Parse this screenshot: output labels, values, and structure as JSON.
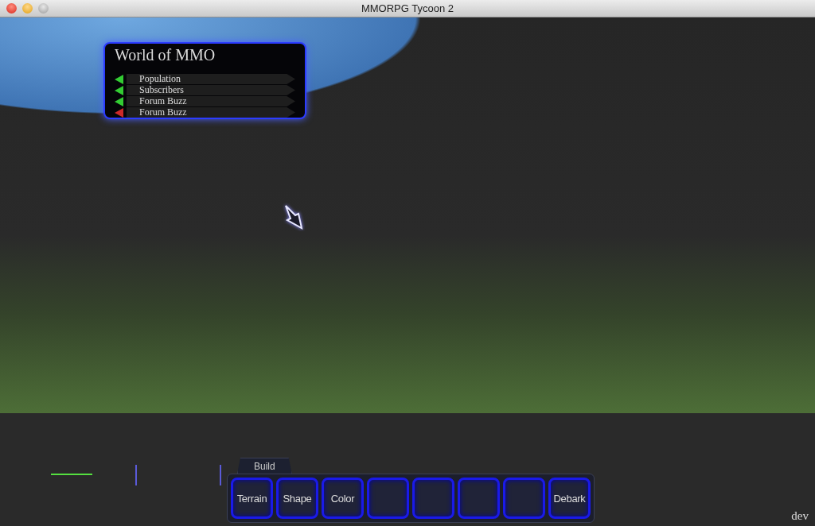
{
  "window": {
    "title": "MMORPG Tycoon 2"
  },
  "game_panel": {
    "title": "World of MMO",
    "stats": [
      {
        "label": "Population",
        "color": "#33cc33"
      },
      {
        "label": "Subscribers",
        "color": "#33cc33"
      },
      {
        "label": "Forum Buzz",
        "color": "#33cc33"
      },
      {
        "label": "Forum Buzz",
        "color": "#cc2a2a"
      }
    ]
  },
  "toolbar": {
    "tab": "Build",
    "slots": [
      {
        "kind": "tool",
        "label": "Terrain"
      },
      {
        "kind": "tool",
        "label": "Shape"
      },
      {
        "kind": "tool",
        "label": "Color"
      },
      {
        "kind": "empty"
      },
      {
        "kind": "empty"
      },
      {
        "kind": "empty"
      },
      {
        "kind": "empty"
      },
      {
        "kind": "tool",
        "label": "Debark"
      }
    ]
  },
  "corner_label": "dev"
}
